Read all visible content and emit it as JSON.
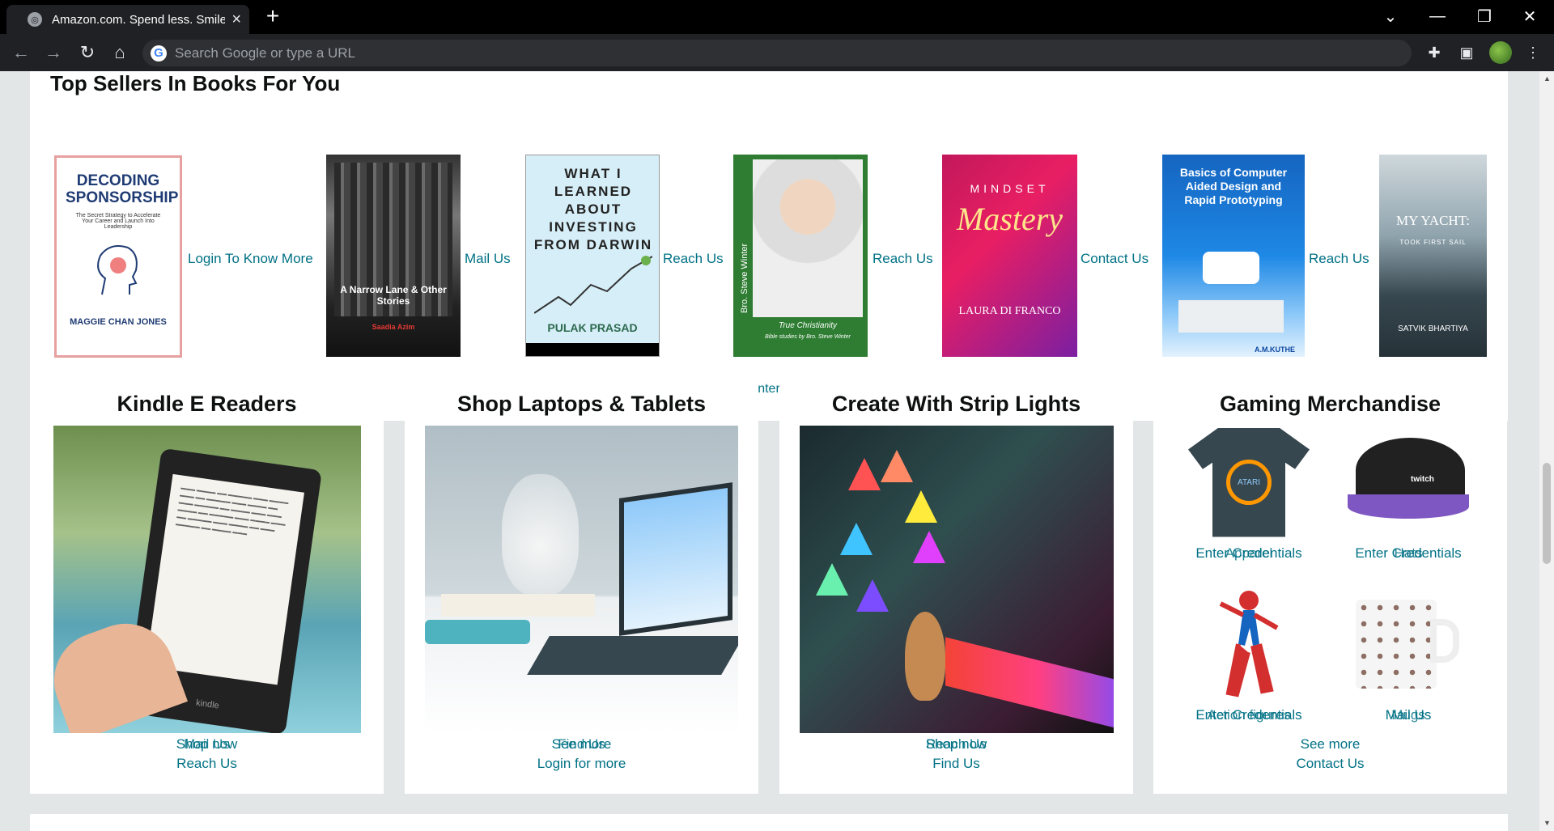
{
  "browser": {
    "tab_title": "Amazon.com. Spend less. Smile more.",
    "tab_close": "×",
    "new_tab": "+",
    "omnibox_placeholder": "Search Google or type a URL",
    "google_letter": "G",
    "window_min": "—",
    "window_restore": "❐",
    "window_close": "✕",
    "tab_list": "⌄"
  },
  "top_sellers": {
    "title": "Top Sellers In Books For You",
    "books": [
      {
        "link": "Login To Know More",
        "cover_title": "DECODING SPONSORSHIP",
        "cover_sub": "The Secret Strategy to Accelerate Your Career and Launch Into Leadership",
        "author": "MAGGIE CHAN JONES"
      },
      {
        "link": "Mail Us",
        "cover_title": "A Narrow Lane & Other Stories",
        "author": "Saadia Azim"
      },
      {
        "link": "Reach Us",
        "cover_title": "WHAT I LEARNED ABOUT INVESTING FROM DARWIN",
        "author": "PULAK PRASAD"
      },
      {
        "link": "Reach Us",
        "cover_title": "True Christianity",
        "author": "Bro. Steve Winter",
        "cover_sub": "Bible studies by Bro. Steve Winter"
      },
      {
        "link": "Contact Us",
        "cover_title": "Mastery",
        "cover_pre": "MINDSET",
        "author": "LAURA DI FRANCO"
      },
      {
        "link": "Reach Us",
        "cover_title": "Basics of Computer Aided Design and Rapid Prototyping",
        "author": "A.M.KUTHE"
      },
      {
        "link": "",
        "cover_title": "MY YACHT:",
        "cover_sub": "TOOK FIRST SAIL",
        "author": "SATVIK BHARTIYA"
      }
    ],
    "footer_link": "Reach Us Enter Credentials"
  },
  "cards": [
    {
      "title": "Kindle E Readers",
      "link1a": "Shop now",
      "link1b": "Mail Us",
      "link2": "Reach Us"
    },
    {
      "title": "Shop Laptops & Tablets",
      "link1a": "See more",
      "link1b": "Find Us",
      "link2": "Login for more"
    },
    {
      "title": "Create With Strip Lights",
      "link1a": "Shop now",
      "link1b": "Reach Us",
      "link2": "Find Us"
    },
    {
      "title": "Gaming Merchandise",
      "items": [
        {
          "a": "Enter Credentials",
          "b": "Apparel"
        },
        {
          "a": "Enter Credentials",
          "b": "Hats"
        },
        {
          "a": "Enter Credentials",
          "b": "Action figures"
        },
        {
          "a": "Mail Us",
          "b": "Mugs"
        }
      ],
      "link1": "See more",
      "link2": "Contact Us"
    }
  ]
}
